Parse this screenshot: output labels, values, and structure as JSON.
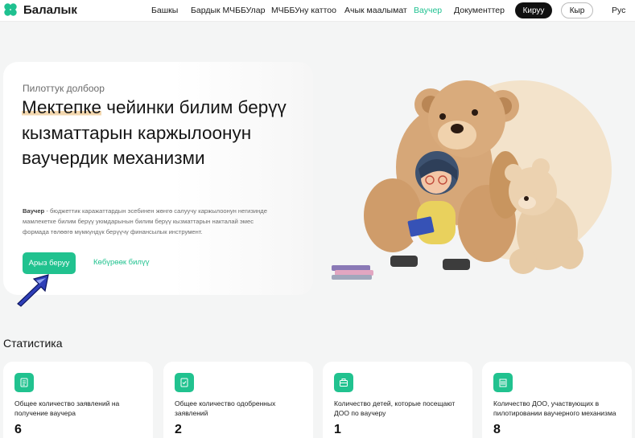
{
  "header": {
    "brand": "Балалык",
    "nav": [
      "Башкы",
      "Бардык МЧББУлар",
      "МЧББУну каттоо",
      "Ачык маалымат",
      "Ваучер",
      "Документтер"
    ],
    "active_nav": "Ваучер",
    "login_label": "Кируу",
    "lang_button": "Кыр",
    "lang_alt": "Рус",
    "accent_color": "#1fc190"
  },
  "hero": {
    "eyebrow": "Пилоттук долбоор",
    "title_highlight": "Мектепке",
    "title_rest": " чейинки билим берүү кызматтарын каржылоонун ваучердик механизми",
    "desc_bold": "Ваучер",
    "desc_rest": " - бюджеттик каражаттардын эсебинен жөнгө салуучу каржылоонун негизинде мамлекетке билим берүү уюмдарынын билим берүү кызматтарын накталай эмес формада төлөөгө мүмкүндүк берүүчү финансылык инструмент.",
    "apply_label": "Арыз беруу",
    "more_label": "Көбүрөөк билүү"
  },
  "stats": {
    "title": "Статистика",
    "cards": [
      {
        "icon": "document-icon",
        "label": "Общее количество заявлений на получение ваучера",
        "value": "6"
      },
      {
        "icon": "approved-document-icon",
        "label": "Общее количество одобренных заявлений",
        "value": "2"
      },
      {
        "icon": "briefcase-icon",
        "label": "Количество детей, которые посещают ДОО по ваучеру",
        "value": "1"
      },
      {
        "icon": "building-icon",
        "label": "Количество ДОО, участвующих в пилотировании ваучерного механизма",
        "value": "8"
      }
    ]
  }
}
